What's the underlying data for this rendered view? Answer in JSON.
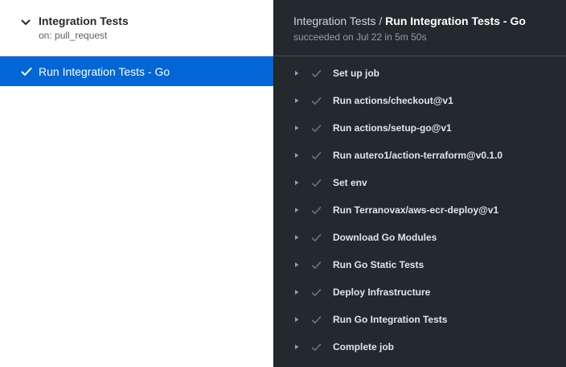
{
  "workflow": {
    "title": "Integration Tests",
    "trigger": "on: pull_request"
  },
  "jobs": [
    {
      "label": "Run Integration Tests - Go",
      "status": "success",
      "selected": true
    }
  ],
  "main": {
    "breadcrumb_workflow": "Integration Tests",
    "breadcrumb_sep": "/",
    "breadcrumb_job": "Run Integration Tests - Go",
    "status_text": "succeeded on Jul 22 in 5m 50s"
  },
  "steps": [
    {
      "label": "Set up job"
    },
    {
      "label": "Run actions/checkout@v1"
    },
    {
      "label": "Run actions/setup-go@v1"
    },
    {
      "label": "Run autero1/action-terraform@v0.1.0"
    },
    {
      "label": "Set env"
    },
    {
      "label": "Run Terranovax/aws-ecr-deploy@v1"
    },
    {
      "label": "Download Go Modules"
    },
    {
      "label": "Run Go Static Tests"
    },
    {
      "label": "Deploy Infrastructure"
    },
    {
      "label": "Run Go Integration Tests"
    },
    {
      "label": "Complete job"
    }
  ],
  "colors": {
    "accent": "#0366d6",
    "panel_dark": "#24292e",
    "step_check": "#6a737d"
  }
}
